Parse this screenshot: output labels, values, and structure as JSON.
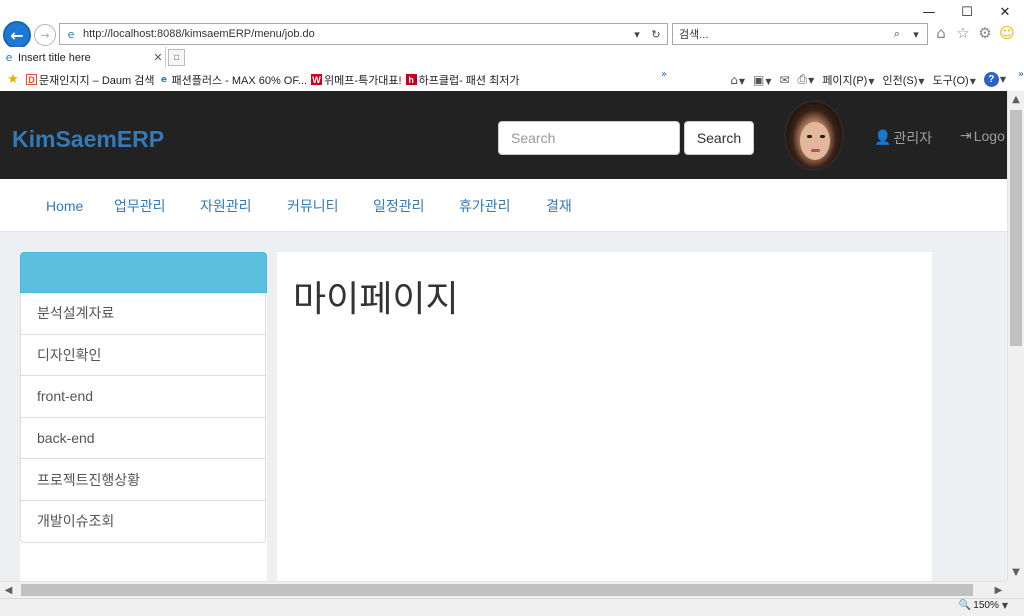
{
  "window": {
    "minimize": "—",
    "maximize": "☐",
    "close": "✕"
  },
  "address_bar": {
    "url": "http://localhost:8088/kimsaemERP/menu/job.do",
    "search_placeholder": "검색..."
  },
  "tab": {
    "title": "Insert title here"
  },
  "favorites": [
    {
      "badge": "D",
      "label": "문재인지지 – Daum 검색"
    },
    {
      "badge": "e",
      "label": "패션플러스 - MAX 60% OF..."
    },
    {
      "badge": "W",
      "label": "위메프-특가대표!"
    },
    {
      "badge": "h",
      "label": "하프클럽- 패션 최저가"
    }
  ],
  "command_bar": {
    "page": "페이지(P)",
    "safety": "인전(S)",
    "tools": "도구(O)"
  },
  "app": {
    "brand": "KimSaemERP",
    "search_placeholder": "Search",
    "search_button": "Search",
    "user_label": "관리자",
    "logout_label": "Logo"
  },
  "nav": [
    {
      "label": "Home"
    },
    {
      "label": "업무관리"
    },
    {
      "label": "자원관리"
    },
    {
      "label": "커뮤니티"
    },
    {
      "label": "일정관리"
    },
    {
      "label": "휴가관리"
    },
    {
      "label": "결재"
    }
  ],
  "sidebar": {
    "items": [
      {
        "label": "분석설계자료"
      },
      {
        "label": "디자인확인"
      },
      {
        "label": "front-end"
      },
      {
        "label": "back-end"
      },
      {
        "label": "프로젝트진행상황"
      },
      {
        "label": "개발이슈조회"
      }
    ]
  },
  "main": {
    "title": "마이페이지"
  },
  "status": {
    "zoom": "150%"
  }
}
